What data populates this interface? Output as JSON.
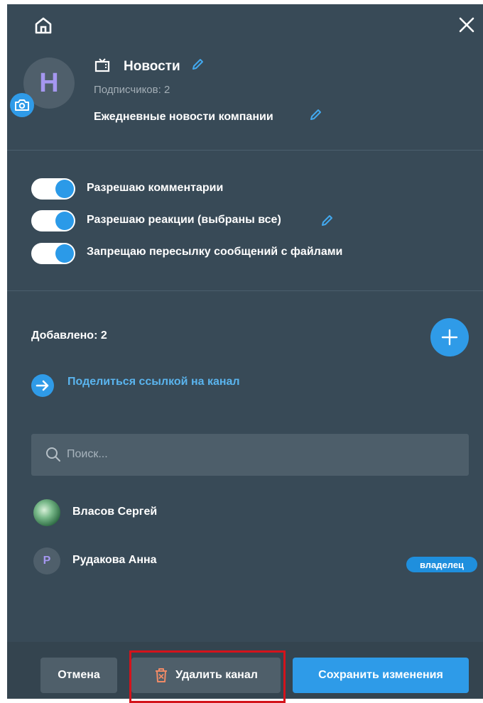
{
  "channel": {
    "avatar_letter": "Н",
    "name": "Новости",
    "subscribers": "Подписчиков: 2",
    "description": "Ежедневные новости компании"
  },
  "settings": [
    {
      "label": "Разрешаю комментарии",
      "enabled": true
    },
    {
      "label": "Разрешаю реакции (выбраны все)",
      "enabled": true
    },
    {
      "label": "Запрещаю пересылку сообщений с файлами",
      "enabled": true
    }
  ],
  "members": {
    "added_label": "Добавлено: 2",
    "share_link": "Поделиться ссылкой на канал",
    "search_placeholder": "Поиск...",
    "list": [
      {
        "name": "Власов Сергей",
        "avatar_letter": "",
        "badge": ""
      },
      {
        "name": "Рудакова Анна",
        "avatar_letter": "Р",
        "badge": "владелец"
      }
    ]
  },
  "footer": {
    "cancel": "Отмена",
    "delete": "Удалить канал",
    "save": "Сохранить изменения"
  },
  "icons": {
    "home": "home-icon",
    "close": "close-icon",
    "camera": "camera-icon",
    "tv": "tv-icon",
    "edit": "pencil-icon",
    "add": "plus-icon",
    "share": "arrow-right-icon",
    "search": "search-icon",
    "delete": "trash-icon"
  },
  "colors": {
    "panel": "#384a57",
    "accent": "#2f9be8",
    "link": "#5ab4ee",
    "highlight": "#d4131b"
  }
}
